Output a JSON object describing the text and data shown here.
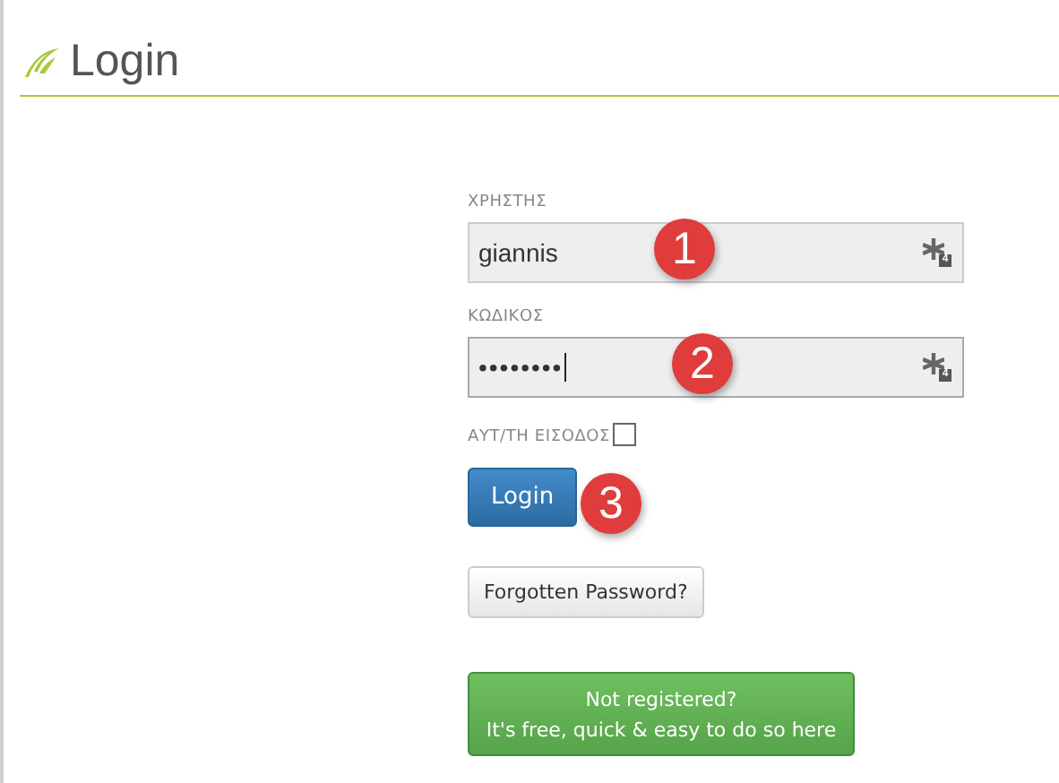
{
  "header": {
    "title": "Login"
  },
  "fields": [
    {
      "label": "ΧΡΗΣΤΗΣ",
      "value": "giannis",
      "focused": false,
      "icon_badge": "4",
      "marker": "1"
    },
    {
      "label": "ΚΩΔΙΚΟΣ",
      "value": "••••••••",
      "focused": true,
      "icon_badge": "4",
      "marker": "2"
    }
  ],
  "remember": {
    "label": "ΑΥΤ/ΤΗ ΕΙΣΟΔΟΣ",
    "checked": false
  },
  "login_button": {
    "label": "Login",
    "marker": "3"
  },
  "forgot_button": {
    "label": "Forgotten Password?"
  },
  "register_button": {
    "lines": [
      "Not registered?",
      "It's free, quick & easy to do so here"
    ]
  }
}
